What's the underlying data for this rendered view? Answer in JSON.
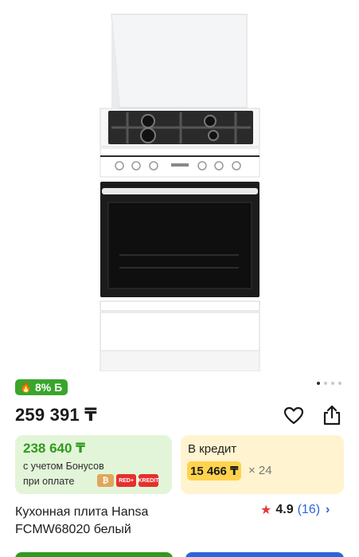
{
  "gallery": {
    "image_alt": "Hansa white gas cooker",
    "dots": 4,
    "active_dot": 0
  },
  "badge": {
    "bonus_percent": "8% Б",
    "icon": "flame-icon"
  },
  "price": {
    "main": "259 391 ₸"
  },
  "actions": {
    "favorite_icon": "heart-icon",
    "share_icon": "share-icon"
  },
  "bonus_card": {
    "price": "238 640 ₸",
    "line1": "с учетом Бонусов",
    "line2": "при оплате",
    "pay_methods": [
      "₿",
      "RED+",
      "KREDIT"
    ]
  },
  "credit_card": {
    "title": "В кредит",
    "amount": "15 466 ₸",
    "months": "× 24"
  },
  "product": {
    "title_line1": "Кухонная плита Hansa",
    "title_line2": "FCMW68020 белый"
  },
  "rating": {
    "score": "4.9",
    "count": "(16)"
  },
  "colors": {
    "accent_green": "#2f9b1e",
    "accent_blue": "#2a66d9",
    "badge_green": "#3aa52b",
    "credit_yellow": "#ffd34e",
    "star_red": "#e23b3b"
  }
}
